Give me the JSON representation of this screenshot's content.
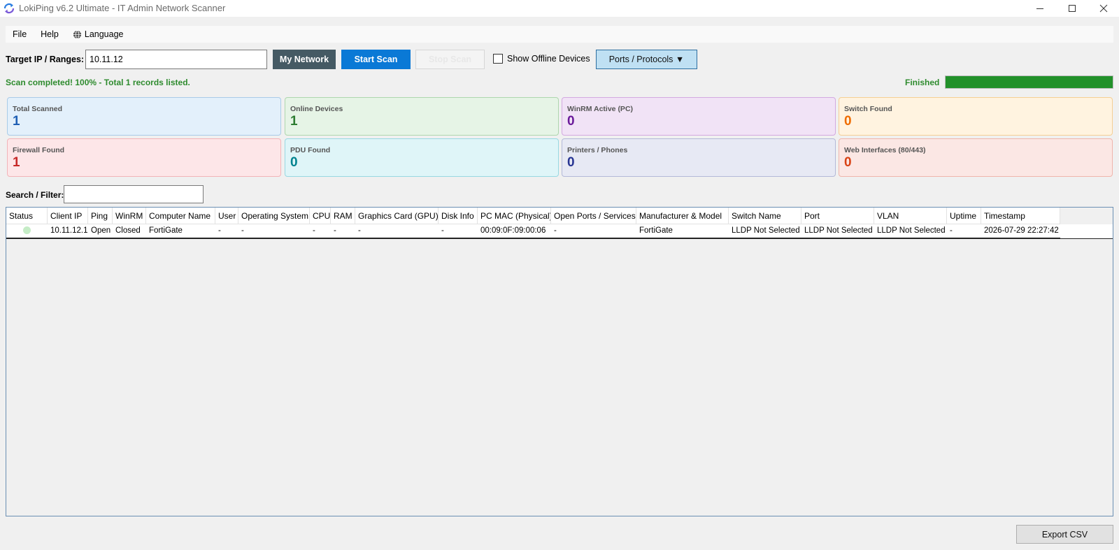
{
  "window": {
    "title": "LokiPing v6.2 Ultimate - IT Admin Network Scanner",
    "icon": "sync-arrows-icon",
    "controls": [
      "minimize",
      "maximize",
      "close"
    ]
  },
  "menu": {
    "file": "File",
    "help": "Help",
    "language": "Language"
  },
  "toolbar": {
    "target_label": "Target IP / Ranges:",
    "target_value": "10.11.12",
    "my_network": "My Network",
    "start_scan": "Start Scan",
    "stop_scan": "Stop Scan",
    "show_offline": "Show Offline Devices",
    "show_offline_checked": false,
    "ports_protocols": "Ports / Protocols ▼"
  },
  "status": {
    "message": "Scan completed! 100% - Total 1 records listed.",
    "state": "Finished",
    "progress_percent": 100
  },
  "cards": [
    {
      "title": "Total Scanned",
      "value": "1",
      "bg": "#e3f0fb",
      "border": "#a9cbe8",
      "color": "#1f5fb4"
    },
    {
      "title": "Online Devices",
      "value": "1",
      "bg": "#e6f4e6",
      "border": "#aed6ae",
      "color": "#2e7d32"
    },
    {
      "title": "WinRM Active (PC)",
      "value": "0",
      "bg": "#f1e3f6",
      "border": "#d3a9e0",
      "color": "#6a1b9a"
    },
    {
      "title": "Switch Found",
      "value": "0",
      "bg": "#fff3e0",
      "border": "#f5cf94",
      "color": "#ef6c00"
    },
    {
      "title": "Firewall Found",
      "value": "1",
      "bg": "#fde6e8",
      "border": "#f2b3b8",
      "color": "#c62828"
    },
    {
      "title": "PDU Found",
      "value": "0",
      "bg": "#dff5f8",
      "border": "#98d8e2",
      "color": "#00838f"
    },
    {
      "title": "Printers / Phones",
      "value": "0",
      "bg": "#e7e9f4",
      "border": "#b3b9d8",
      "color": "#283593"
    },
    {
      "title": "Web Interfaces (80/443)",
      "value": "0",
      "bg": "#fbe7e4",
      "border": "#efb5ab",
      "color": "#d84315"
    }
  ],
  "search": {
    "label": "Search / Filter:",
    "value": ""
  },
  "grid": {
    "columns": [
      "Status",
      "Client IP",
      "Ping",
      "WinRM",
      "Computer Name",
      "User",
      "Operating System",
      "CPU",
      "RAM",
      "Graphics Card (GPU)",
      "Disk Info",
      "PC MAC (Physical)",
      "Open Ports / Services",
      "Manufacturer & Model",
      "Switch Name",
      "Port",
      "VLAN",
      "Uptime",
      "Timestamp"
    ],
    "rows": [
      [
        "",
        "10.11.12.1",
        "Open",
        "Closed",
        "FortiGate",
        "-",
        "-",
        "-",
        "-",
        "-",
        "-",
        "00:09:0F:09:00:06",
        "-",
        "FortiGate",
        "LLDP Not Selected",
        "LLDP Not Selected",
        "LLDP Not Selected",
        "-",
        "2026-07-29 22:27:42"
      ]
    ]
  },
  "footer": {
    "export_csv": "Export CSV"
  }
}
